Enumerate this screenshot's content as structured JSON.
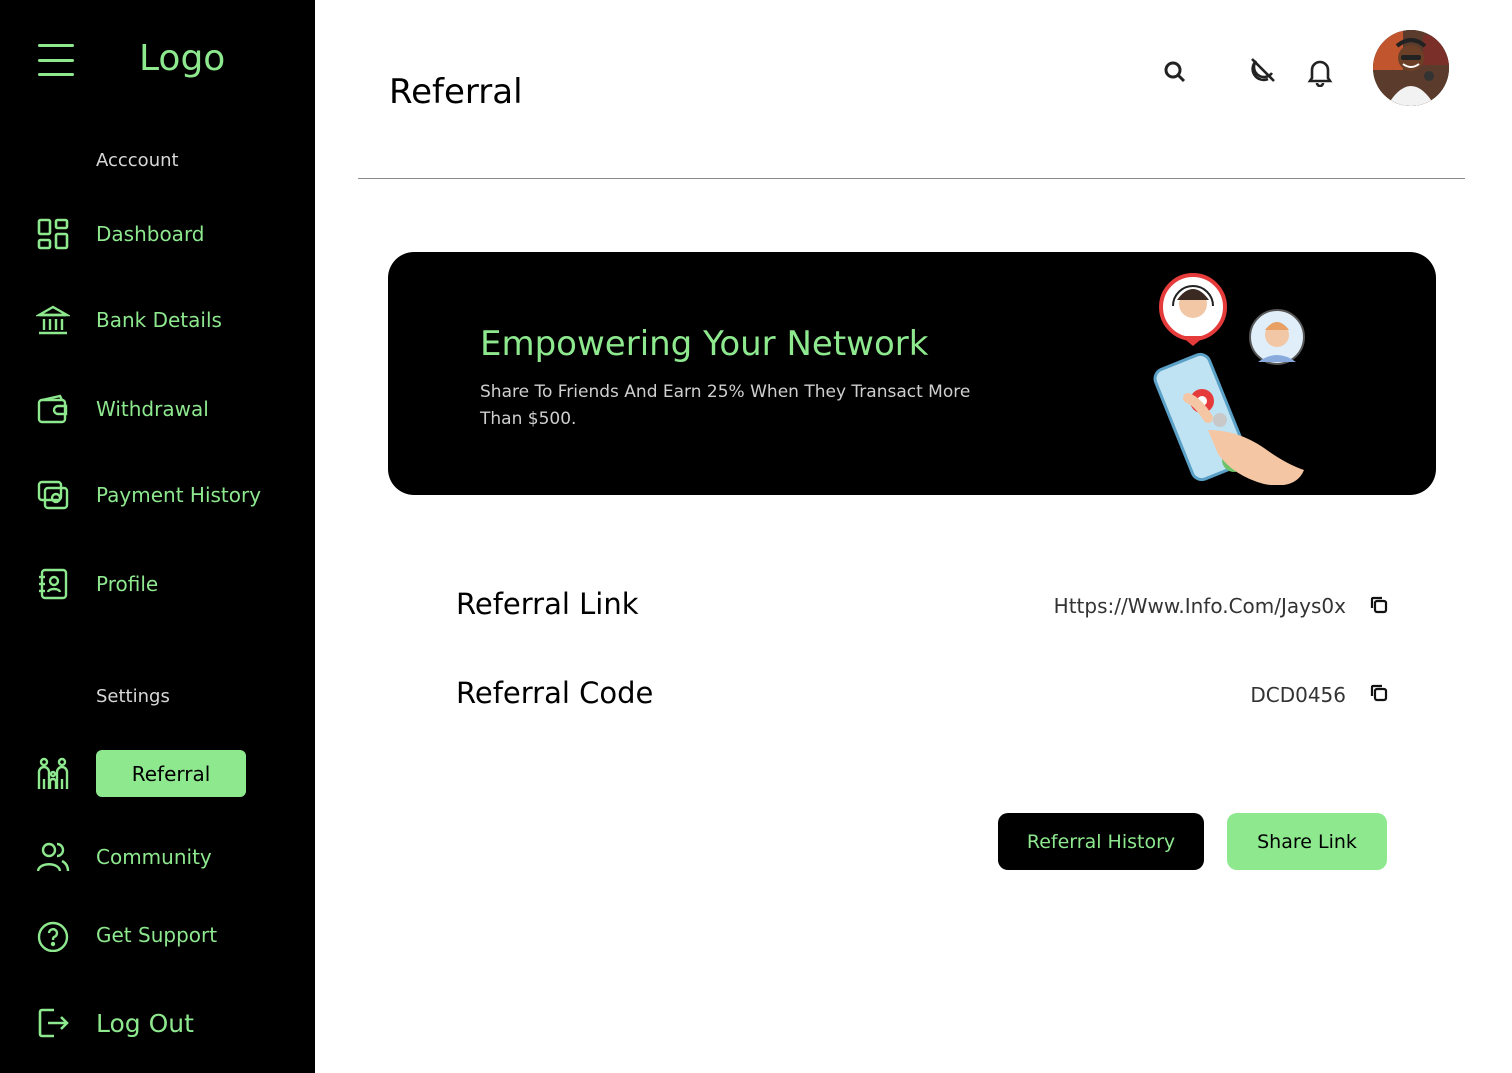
{
  "sidebar": {
    "logo": "Logo",
    "account_label": "Acccount",
    "settings_label": "Settings",
    "items": [
      {
        "label": "Dashboard",
        "icon": "dashboard-icon"
      },
      {
        "label": "Bank Details",
        "icon": "bank-icon"
      },
      {
        "label": "Withdrawal",
        "icon": "wallet-icon"
      },
      {
        "label": "Payment History",
        "icon": "payment-history-icon"
      },
      {
        "label": "Profile",
        "icon": "profile-icon"
      }
    ],
    "settings_items": [
      {
        "label": "Referral",
        "icon": "referral-icon",
        "active": true
      },
      {
        "label": "Community",
        "icon": "community-icon"
      },
      {
        "label": "Get Support",
        "icon": "help-icon"
      },
      {
        "label": "Log Out",
        "icon": "logout-icon"
      }
    ]
  },
  "header": {
    "title": "Referral"
  },
  "banner": {
    "title": "Empowering Your Network",
    "text": "Share To Friends And Earn 25% When They Transact More Than $500."
  },
  "referral": {
    "link_label": "Referral Link",
    "link_value": "Https://Www.Info.Com/Jays0x",
    "code_label": "Referral Code",
    "code_value": "DCD0456"
  },
  "actions": {
    "history_label": "Referral History",
    "share_label": "Share Link"
  },
  "colors": {
    "accent": "#8de88e",
    "sidebar_bg": "#000000"
  }
}
